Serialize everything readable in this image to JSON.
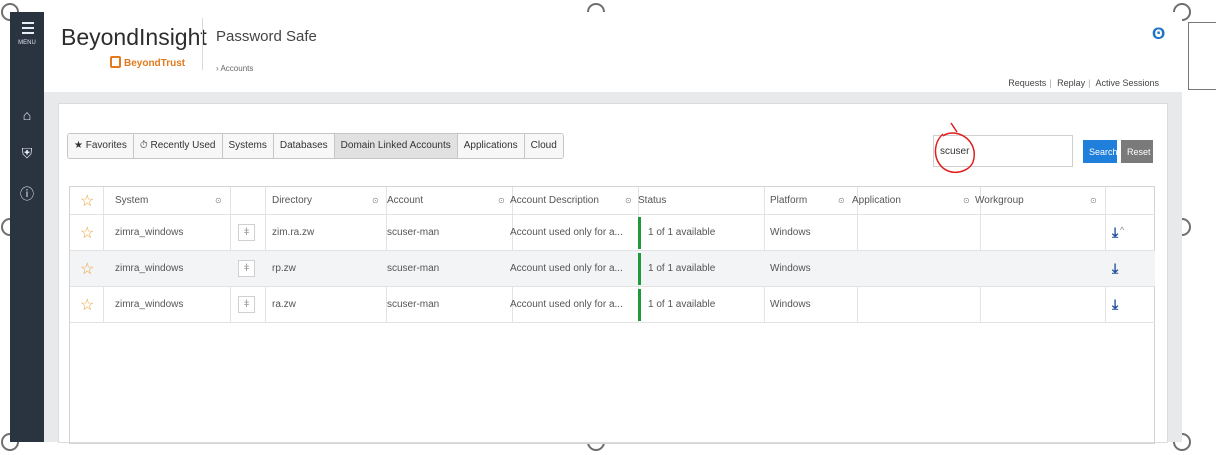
{
  "sidebar": {
    "menu_label": "MENU",
    "icons": [
      "home-icon",
      "shield-icon",
      "info-icon"
    ]
  },
  "header": {
    "brand": "BeyondInsight",
    "brand_sub": "BeyondTrust",
    "module": "Password Safe",
    "breadcrumb": "Accounts",
    "user_icon": "user-icon",
    "links": [
      "Requests",
      "Replay",
      "Active Sessions"
    ]
  },
  "tabs": [
    {
      "icon": "★",
      "label": "Favorites"
    },
    {
      "icon": "⏱",
      "label": "Recently Used"
    },
    {
      "icon": "",
      "label": "Systems"
    },
    {
      "icon": "",
      "label": "Databases"
    },
    {
      "icon": "",
      "label": "Domain Linked Accounts"
    },
    {
      "icon": "",
      "label": "Applications"
    },
    {
      "icon": "",
      "label": "Cloud"
    }
  ],
  "search": {
    "value": "scuser",
    "search_label": "Search",
    "reset_label": "Reset"
  },
  "table": {
    "headers": {
      "system": "System",
      "directory": "Directory",
      "account": "Account",
      "description": "Account Description",
      "status": "Status",
      "platform": "Platform",
      "application": "Application",
      "workgroup": "Workgroup"
    },
    "rows": [
      {
        "system": "zimra_windows",
        "directory": "zim.ra.zw",
        "account": "scuser-man",
        "description": "Account used only for a...",
        "status": "1 of 1 available",
        "platform": "Windows"
      },
      {
        "system": "zimra_windows",
        "directory": "rp.zw",
        "account": "scuser-man",
        "description": "Account used only for a...",
        "status": "1 of 1 available",
        "platform": "Windows"
      },
      {
        "system": "zimra_windows",
        "directory": "ra.zw",
        "account": "scuser-man",
        "description": "Account used only for a...",
        "status": "1 of 1 available",
        "platform": "Windows"
      }
    ]
  },
  "colors": {
    "sidebar": "#2a3340",
    "accent": "#1f7fdb",
    "status_ok": "#1f9a3a",
    "annotation": "#e02020"
  }
}
